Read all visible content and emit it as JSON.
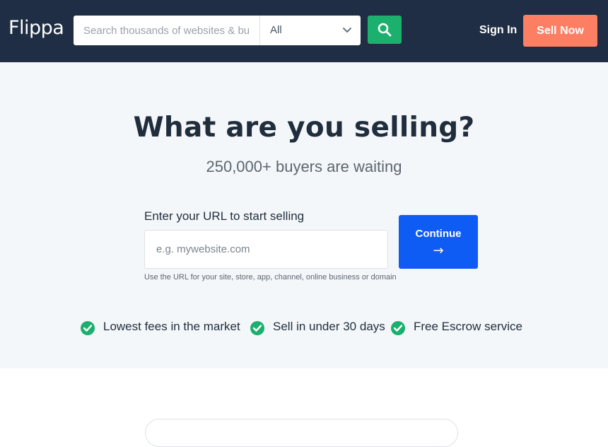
{
  "header": {
    "logo": "Flippa",
    "search_placeholder": "Search thousands of websites & bu",
    "category_selected": "All",
    "signin_label": "Sign In",
    "sell_label": "Sell Now"
  },
  "hero": {
    "title": "What are you selling?",
    "subtitle": "250,000+ buyers are waiting",
    "url_label": "Enter your URL to start selling",
    "url_placeholder": "e.g. mywebsite.com",
    "continue_label": "Continue",
    "continue_arrow": "→",
    "helper_text": "Use the URL for your site, store, app, channel, online business or domain",
    "benefits": [
      "Lowest fees in the market",
      "Sell in under 30 days",
      "Free Escrow service"
    ]
  },
  "colors": {
    "header_bg": "#1f2e44",
    "search_button": "#1bb06e",
    "sell_button": "#fc7f64",
    "continue_button": "#0f5cf5",
    "hero_bg": "#f4f7f9",
    "check": "#1bb06e"
  },
  "icons": {
    "search": "search-icon",
    "dropdown": "chevron-down-icon",
    "continue": "arrow-right-icon",
    "benefit": "check-circle-icon"
  }
}
